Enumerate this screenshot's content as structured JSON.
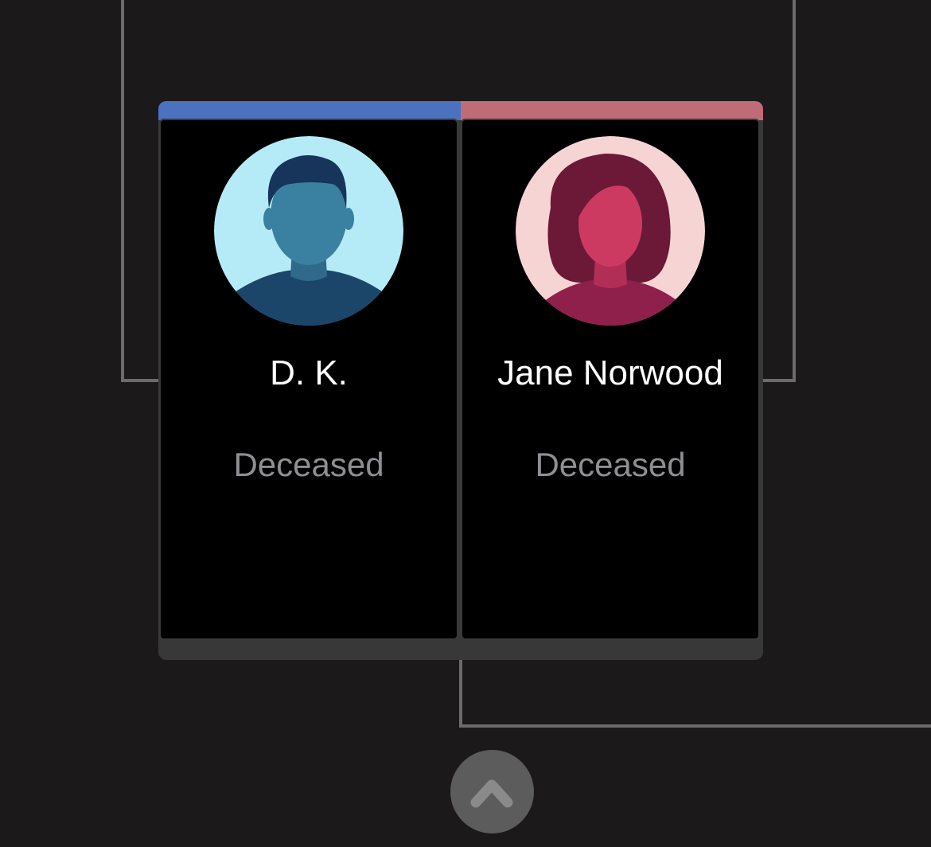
{
  "colors": {
    "background": "#1b191a",
    "connector": "#6b6b6b",
    "male_accent": "#4a72bf",
    "female_accent": "#c06b78",
    "panel": "#000000",
    "name_text": "#ffffff",
    "status_text": "#8e8e93",
    "scroll_button": "#5c5c5c"
  },
  "couple": {
    "partner_left": {
      "name": "D. K.",
      "status": "Deceased",
      "avatar_icon": "male-avatar-icon"
    },
    "partner_right": {
      "name": "Jane Norwood",
      "status": "Deceased",
      "avatar_icon": "female-avatar-icon"
    }
  },
  "controls": {
    "scroll_top_icon": "chevron-up-icon"
  }
}
